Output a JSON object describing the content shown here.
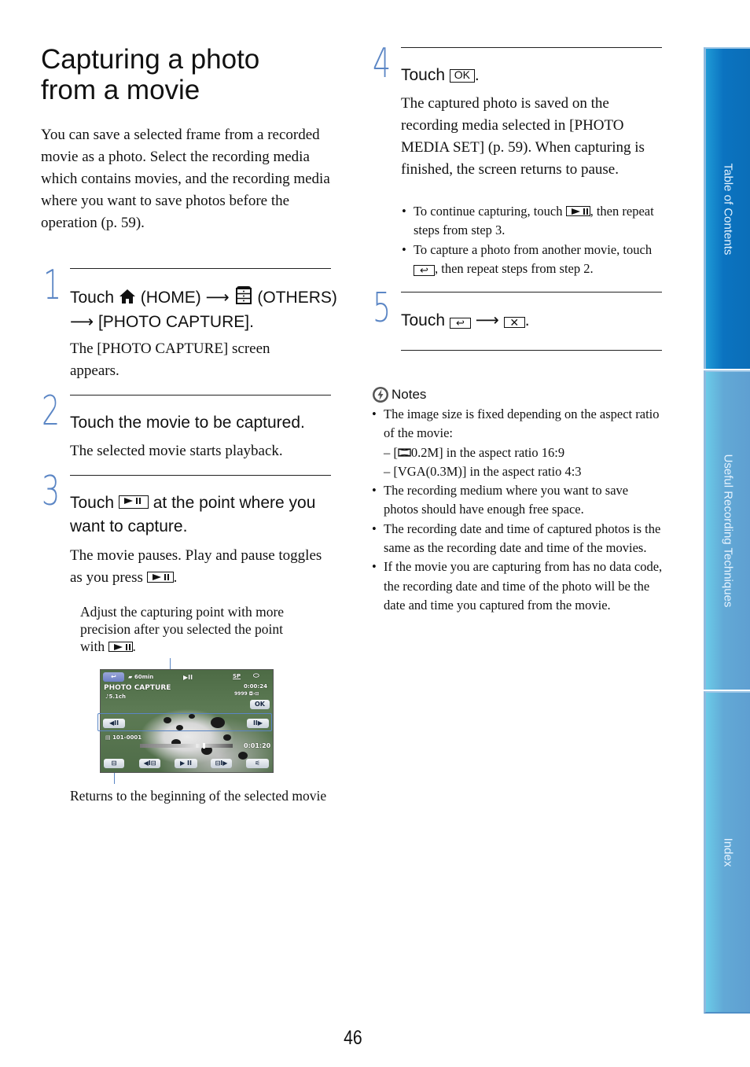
{
  "page": {
    "title_line1": "Capturing a photo",
    "title_line2": "from a movie",
    "intro": "You can save a selected frame from a recorded movie as a photo. Select the recording media which contains movies, and the recording media where you want to save photos before the operation (p. 59).",
    "page_number": "46"
  },
  "steps": [
    {
      "number": "1",
      "head_touch": "Touch",
      "head_home": "(HOME)",
      "head_others": "(OTHERS)",
      "head_tail": "[PHOTO CAPTURE].",
      "body": "The [PHOTO CAPTURE] screen appears."
    },
    {
      "number": "2",
      "head": "Touch the movie to be captured.",
      "body": "The selected movie starts playback."
    },
    {
      "number": "3",
      "head_touch": "Touch",
      "head_tail": "at the point where you want to capture.",
      "body": "The movie pauses. Play and pause toggles as you press",
      "body_end": ".",
      "callout_top": "Adjust the capturing point with more precision after you selected the point with",
      "callout_top_end": ".",
      "callout_bottom": "Returns to the beginning of the selected movie"
    },
    {
      "number": "4",
      "head_touch": "Touch",
      "ok_label": "OK",
      "head_end": ".",
      "body": "The captured photo is saved on the recording media selected in [PHOTO MEDIA SET] (p. 59). When capturing is finished, the screen returns to pause.",
      "bullet1_pre": "To continue capturing, touch",
      "bullet1_post": ", then repeat steps from step 3.",
      "bullet2_pre": "To capture a photo from another movie, touch",
      "bullet2_post": ", then repeat steps from step 2."
    },
    {
      "number": "5",
      "head_touch": "Touch",
      "head_end": "."
    }
  ],
  "icons": {
    "return_glyph": "↩",
    "close_glyph": "✕",
    "arrow_glyph": "⟶"
  },
  "screen": {
    "battery": "60min",
    "title": "PHOTO CAPTURE",
    "audio": "♪5.1ch",
    "mode": "SP",
    "time_top": "0:00:24",
    "remaining": "9999",
    "ok": "OK",
    "folder": "101-0001",
    "time_bottom": "0:01:20",
    "playback_progress": 0.68
  },
  "notes": {
    "heading": "Notes",
    "items": [
      "The image size is fixed depending on the aspect ratio of the movie:",
      "The recording medium where you want to save photos should have enough free space.",
      "The recording date and time of captured photos is the same as the recording date and time of the movies.",
      "If the movie you are capturing from has no data code, the recording date and time of the photo will be the date and time you captured from the movie."
    ],
    "sub_items": [
      "– [",
      "0.2M] in the aspect ratio 16:9",
      "– [VGA(0.3M)] in the aspect ratio 4:3"
    ]
  },
  "sidebar": {
    "tabs": [
      {
        "label": "Table of Contents"
      },
      {
        "label": "Useful Recording Techniques"
      },
      {
        "label": "Index"
      }
    ]
  }
}
